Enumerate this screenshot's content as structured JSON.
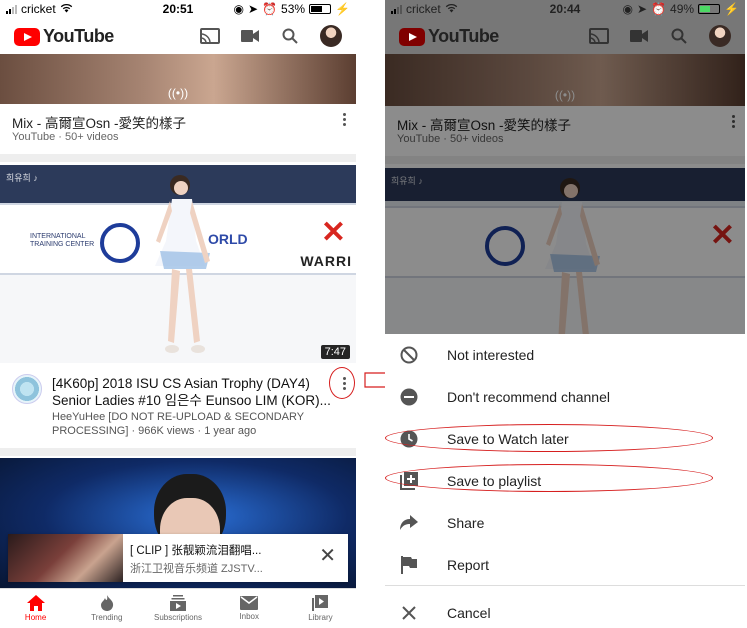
{
  "left": {
    "status": {
      "carrier": "cricket",
      "time": "20:51",
      "battery": "53%",
      "battery_level": 0.53
    },
    "app": {
      "logo_text": "YouTube"
    },
    "mix": {
      "title": "Mix - 高爾宣Osn -愛笑的樣子",
      "subtitle": "YouTube · 50+ videos"
    },
    "video": {
      "title": "[4K60p] 2018 ISU CS Asian Trophy (DAY4) Senior Ladies #10 임은수 Eunsoo LIM (KOR)...",
      "meta": "HeeYuHee [DO NOT RE-UPLOAD & SECONDARY PROCESSING] · 966K views · 1 year ago",
      "duration": "7:47",
      "banner_text": "INTERNATIONAL TRAINING CENTER",
      "banner_brand": "ORLD",
      "banner_brand2": "WARRI"
    },
    "miniplayer": {
      "title": "[ CLIP ] 张靓颖流泪翻唱...",
      "channel": "浙江卫视音乐频道 ZJSTV..."
    },
    "bottom_nav": [
      {
        "label": "Home",
        "icon": "home-icon",
        "active": true
      },
      {
        "label": "Trending",
        "icon": "fire-icon",
        "active": false
      },
      {
        "label": "Subscriptions",
        "icon": "subscriptions-icon",
        "active": false
      },
      {
        "label": "Inbox",
        "icon": "mail-icon",
        "active": false
      },
      {
        "label": "Library",
        "icon": "library-icon",
        "active": false
      }
    ]
  },
  "right": {
    "status": {
      "carrier": "cricket",
      "time": "20:44",
      "battery": "49%",
      "battery_level": 0.49
    },
    "app": {
      "logo_text": "YouTube"
    },
    "mix": {
      "title": "Mix - 高爾宣Osn -愛笑的樣子",
      "subtitle": "YouTube · 50+ videos"
    },
    "menu": [
      {
        "label": "Not interested",
        "icon": "block-icon"
      },
      {
        "label": "Don't recommend channel",
        "icon": "remove-circle-icon"
      },
      {
        "label": "Save to Watch later",
        "icon": "clock-icon"
      },
      {
        "label": "Save to playlist",
        "icon": "playlist-add-icon"
      },
      {
        "label": "Share",
        "icon": "share-icon"
      },
      {
        "label": "Report",
        "icon": "flag-icon"
      }
    ],
    "cancel": {
      "label": "Cancel",
      "icon": "close-icon"
    }
  },
  "colors": {
    "brand": "#ff0000",
    "annotation": "#d61f1f"
  }
}
